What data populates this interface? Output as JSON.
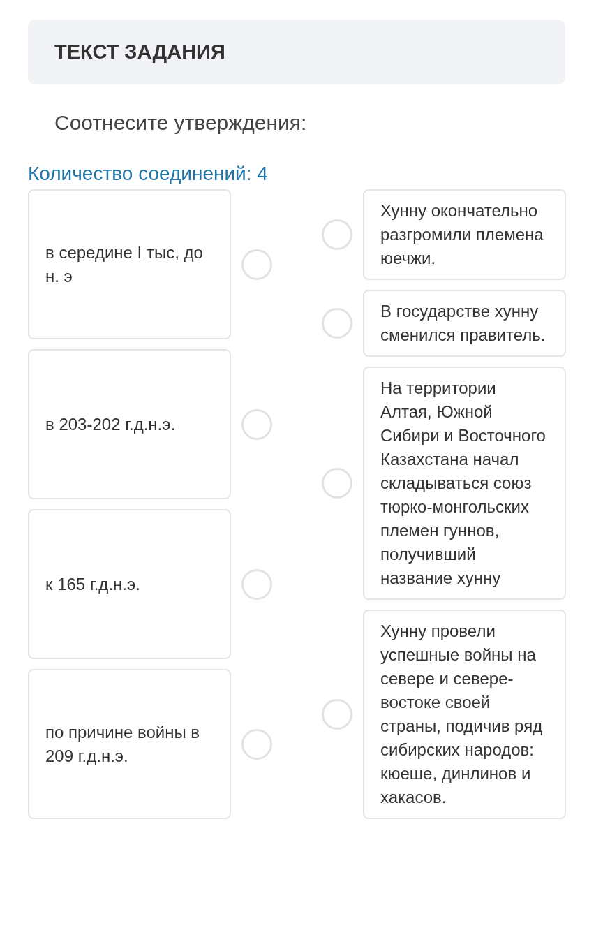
{
  "header": {
    "title": "ТЕКСТ ЗАДАНИЯ"
  },
  "prompt": "Соотнесите утверждения:",
  "connections_count": "Количество соединений: 4",
  "left_items": [
    {
      "text": "в середине I тыс, до н. э"
    },
    {
      "text": "в 203-202 г.д.н.э."
    },
    {
      "text": "к 165 г.д.н.э."
    },
    {
      "text": "по причине войны в 209 г.д.н.э."
    }
  ],
  "right_items": [
    {
      "text": "Хунну окончательно разгромили племена юечжи."
    },
    {
      "text": "В государстве хунну сменился правитель."
    },
    {
      "text": "На территории Алтая, Южной Сибири и Восточного Казахстана начал складываться союз тюрко-монгольских племен гуннов, получивший название хунну"
    },
    {
      "text": "Хунну провели успешные войны на севере и севере-востоке своей страны, подичив ряд сибирских народов: кюеше, динлинов и хакасов."
    }
  ]
}
